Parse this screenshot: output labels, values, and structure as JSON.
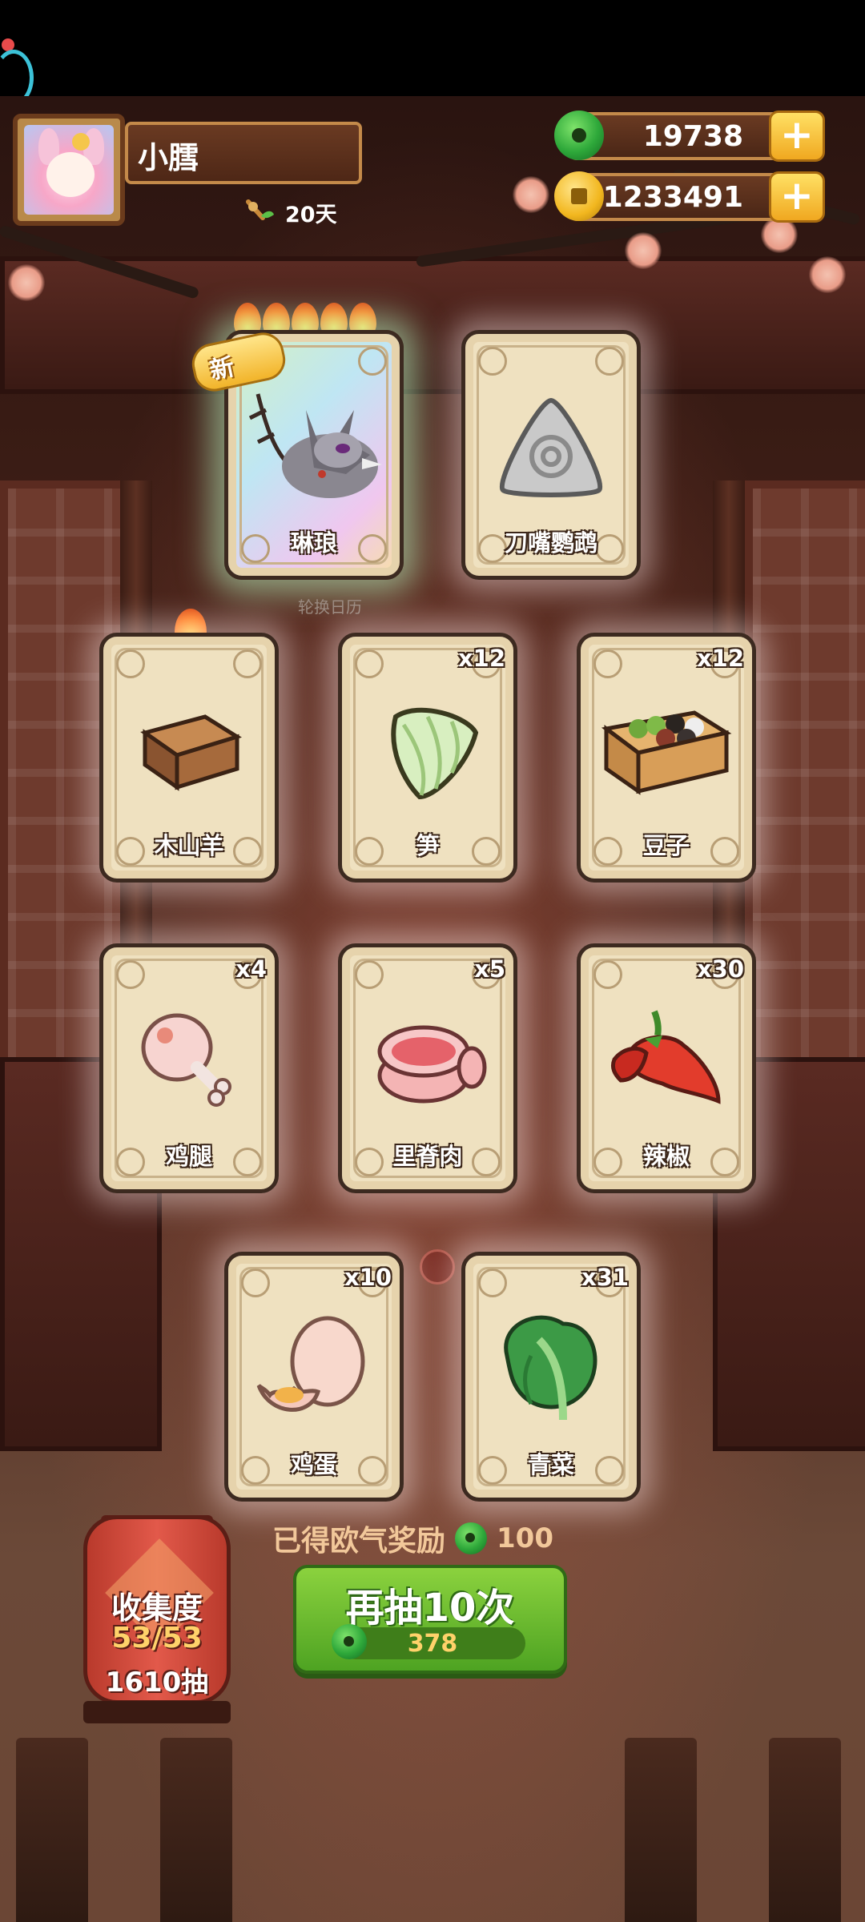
{
  "player": {
    "name": "小膤",
    "days": "20天"
  },
  "currency": {
    "jade": "19738",
    "coins": "1233491",
    "plus_symbol": "+"
  },
  "cards": [
    {
      "name": "琳琅",
      "count": "",
      "badge": "新",
      "rare": true
    },
    {
      "name": "刀嘴鹦鹉",
      "count": ""
    },
    {
      "name": "木山羊",
      "count": ""
    },
    {
      "name": "笋",
      "count": "x12"
    },
    {
      "name": "豆子",
      "count": "x12"
    },
    {
      "name": "鸡腿",
      "count": "x4"
    },
    {
      "name": "里脊肉",
      "count": "x5"
    },
    {
      "name": "辣椒",
      "count": "x30"
    },
    {
      "name": "鸡蛋",
      "count": "x10"
    },
    {
      "name": "青菜",
      "count": "x31"
    }
  ],
  "calendar_label": "轮换日历",
  "reward": {
    "label": "已得欧气奖励",
    "value": "100"
  },
  "collection": {
    "title": "收集度",
    "progress": "53/53",
    "draws": "1610抽"
  },
  "draw_button": {
    "label": "再抽10次",
    "cost": "378"
  },
  "colors": {
    "accent_green": "#4ea322",
    "gold": "#f2b42a",
    "card_bg": "#efe1c0"
  }
}
